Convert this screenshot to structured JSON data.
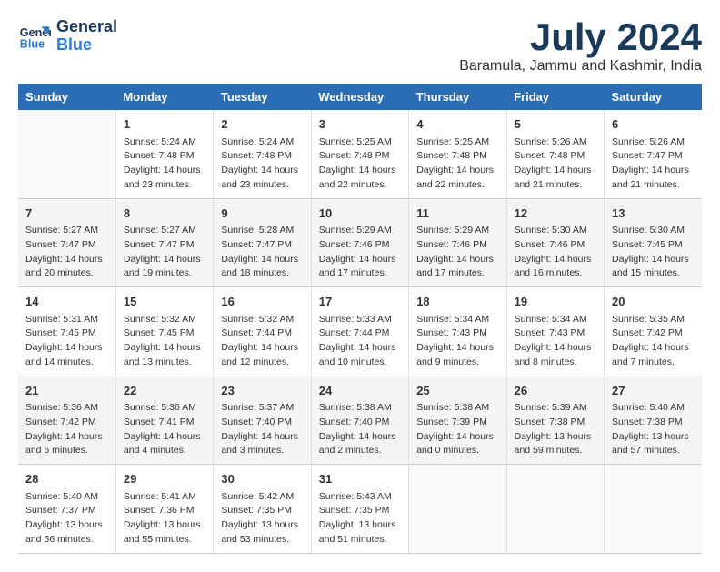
{
  "header": {
    "logo_line1": "General",
    "logo_line2": "Blue",
    "month": "July 2024",
    "location": "Baramula, Jammu and Kashmir, India"
  },
  "weekdays": [
    "Sunday",
    "Monday",
    "Tuesday",
    "Wednesday",
    "Thursday",
    "Friday",
    "Saturday"
  ],
  "weeks": [
    [
      {
        "day": "",
        "content": ""
      },
      {
        "day": "1",
        "content": "Sunrise: 5:24 AM\nSunset: 7:48 PM\nDaylight: 14 hours\nand 23 minutes."
      },
      {
        "day": "2",
        "content": "Sunrise: 5:24 AM\nSunset: 7:48 PM\nDaylight: 14 hours\nand 23 minutes."
      },
      {
        "day": "3",
        "content": "Sunrise: 5:25 AM\nSunset: 7:48 PM\nDaylight: 14 hours\nand 22 minutes."
      },
      {
        "day": "4",
        "content": "Sunrise: 5:25 AM\nSunset: 7:48 PM\nDaylight: 14 hours\nand 22 minutes."
      },
      {
        "day": "5",
        "content": "Sunrise: 5:26 AM\nSunset: 7:48 PM\nDaylight: 14 hours\nand 21 minutes."
      },
      {
        "day": "6",
        "content": "Sunrise: 5:26 AM\nSunset: 7:47 PM\nDaylight: 14 hours\nand 21 minutes."
      }
    ],
    [
      {
        "day": "7",
        "content": "Sunrise: 5:27 AM\nSunset: 7:47 PM\nDaylight: 14 hours\nand 20 minutes."
      },
      {
        "day": "8",
        "content": "Sunrise: 5:27 AM\nSunset: 7:47 PM\nDaylight: 14 hours\nand 19 minutes."
      },
      {
        "day": "9",
        "content": "Sunrise: 5:28 AM\nSunset: 7:47 PM\nDaylight: 14 hours\nand 18 minutes."
      },
      {
        "day": "10",
        "content": "Sunrise: 5:29 AM\nSunset: 7:46 PM\nDaylight: 14 hours\nand 17 minutes."
      },
      {
        "day": "11",
        "content": "Sunrise: 5:29 AM\nSunset: 7:46 PM\nDaylight: 14 hours\nand 17 minutes."
      },
      {
        "day": "12",
        "content": "Sunrise: 5:30 AM\nSunset: 7:46 PM\nDaylight: 14 hours\nand 16 minutes."
      },
      {
        "day": "13",
        "content": "Sunrise: 5:30 AM\nSunset: 7:45 PM\nDaylight: 14 hours\nand 15 minutes."
      }
    ],
    [
      {
        "day": "14",
        "content": "Sunrise: 5:31 AM\nSunset: 7:45 PM\nDaylight: 14 hours\nand 14 minutes."
      },
      {
        "day": "15",
        "content": "Sunrise: 5:32 AM\nSunset: 7:45 PM\nDaylight: 14 hours\nand 13 minutes."
      },
      {
        "day": "16",
        "content": "Sunrise: 5:32 AM\nSunset: 7:44 PM\nDaylight: 14 hours\nand 12 minutes."
      },
      {
        "day": "17",
        "content": "Sunrise: 5:33 AM\nSunset: 7:44 PM\nDaylight: 14 hours\nand 10 minutes."
      },
      {
        "day": "18",
        "content": "Sunrise: 5:34 AM\nSunset: 7:43 PM\nDaylight: 14 hours\nand 9 minutes."
      },
      {
        "day": "19",
        "content": "Sunrise: 5:34 AM\nSunset: 7:43 PM\nDaylight: 14 hours\nand 8 minutes."
      },
      {
        "day": "20",
        "content": "Sunrise: 5:35 AM\nSunset: 7:42 PM\nDaylight: 14 hours\nand 7 minutes."
      }
    ],
    [
      {
        "day": "21",
        "content": "Sunrise: 5:36 AM\nSunset: 7:42 PM\nDaylight: 14 hours\nand 6 minutes."
      },
      {
        "day": "22",
        "content": "Sunrise: 5:36 AM\nSunset: 7:41 PM\nDaylight: 14 hours\nand 4 minutes."
      },
      {
        "day": "23",
        "content": "Sunrise: 5:37 AM\nSunset: 7:40 PM\nDaylight: 14 hours\nand 3 minutes."
      },
      {
        "day": "24",
        "content": "Sunrise: 5:38 AM\nSunset: 7:40 PM\nDaylight: 14 hours\nand 2 minutes."
      },
      {
        "day": "25",
        "content": "Sunrise: 5:38 AM\nSunset: 7:39 PM\nDaylight: 14 hours\nand 0 minutes."
      },
      {
        "day": "26",
        "content": "Sunrise: 5:39 AM\nSunset: 7:38 PM\nDaylight: 13 hours\nand 59 minutes."
      },
      {
        "day": "27",
        "content": "Sunrise: 5:40 AM\nSunset: 7:38 PM\nDaylight: 13 hours\nand 57 minutes."
      }
    ],
    [
      {
        "day": "28",
        "content": "Sunrise: 5:40 AM\nSunset: 7:37 PM\nDaylight: 13 hours\nand 56 minutes."
      },
      {
        "day": "29",
        "content": "Sunrise: 5:41 AM\nSunset: 7:36 PM\nDaylight: 13 hours\nand 55 minutes."
      },
      {
        "day": "30",
        "content": "Sunrise: 5:42 AM\nSunset: 7:35 PM\nDaylight: 13 hours\nand 53 minutes."
      },
      {
        "day": "31",
        "content": "Sunrise: 5:43 AM\nSunset: 7:35 PM\nDaylight: 13 hours\nand 51 minutes."
      },
      {
        "day": "",
        "content": ""
      },
      {
        "day": "",
        "content": ""
      },
      {
        "day": "",
        "content": ""
      }
    ]
  ]
}
